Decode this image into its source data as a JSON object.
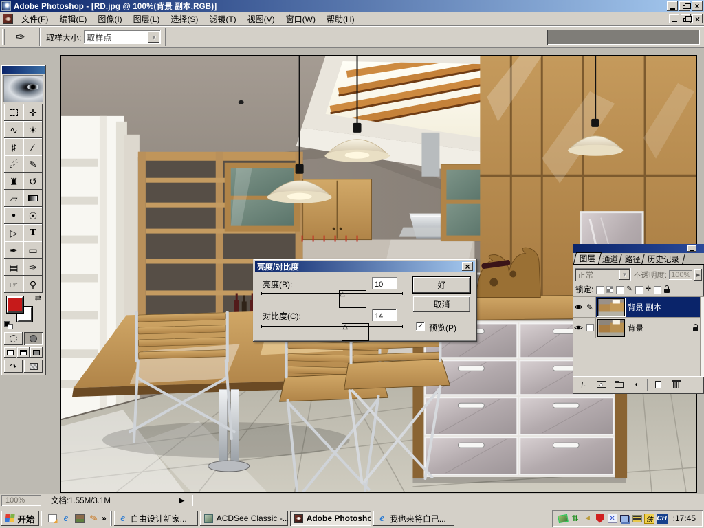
{
  "window": {
    "title": "Adobe Photoshop - [RD.jpg @ 100%(背景 副本,RGB)]"
  },
  "menu_bar": {
    "items": [
      "文件(F)",
      "编辑(E)",
      "图像(I)",
      "图层(L)",
      "选择(S)",
      "滤镜(T)",
      "视图(V)",
      "窗口(W)",
      "帮助(H)"
    ]
  },
  "options_bar": {
    "sample_size_label": "取样大小:",
    "sample_size_value": "取样点"
  },
  "toolbox": {
    "tools": [
      {
        "name": "rectangular-marquee",
        "glyph": ""
      },
      {
        "name": "move",
        "glyph": "✛"
      },
      {
        "name": "lasso",
        "glyph": "∿"
      },
      {
        "name": "magic-wand",
        "glyph": "✶"
      },
      {
        "name": "crop",
        "glyph": "♯"
      },
      {
        "name": "slice",
        "glyph": "∕"
      },
      {
        "name": "airbrush",
        "glyph": "☄"
      },
      {
        "name": "paintbrush",
        "glyph": "✎"
      },
      {
        "name": "clone-stamp",
        "glyph": "♜"
      },
      {
        "name": "history-brush",
        "glyph": "↺"
      },
      {
        "name": "eraser",
        "glyph": "▱"
      },
      {
        "name": "gradient",
        "glyph": ""
      },
      {
        "name": "blur",
        "glyph": "●"
      },
      {
        "name": "dodge",
        "glyph": "☉"
      },
      {
        "name": "path-select",
        "glyph": "▷"
      },
      {
        "name": "type",
        "glyph": "T"
      },
      {
        "name": "pen",
        "glyph": "✒"
      },
      {
        "name": "rectangle",
        "glyph": "▭"
      },
      {
        "name": "notes",
        "glyph": "▤"
      },
      {
        "name": "eyedropper",
        "glyph": "✑"
      },
      {
        "name": "hand",
        "glyph": "☞"
      },
      {
        "name": "zoom",
        "glyph": "⚲"
      }
    ]
  },
  "dialog": {
    "title": "亮度/对比度",
    "brightness_label": "亮度(B):",
    "brightness_value": "10",
    "contrast_label": "对比度(C):",
    "contrast_value": "14",
    "ok_label": "好",
    "cancel_label": "取消",
    "preview_label": "预览(P)"
  },
  "layers_palette": {
    "tabs": [
      "图层",
      "通道",
      "路径",
      "历史记录"
    ],
    "blend_mode_value": "正常",
    "opacity_label": "不透明度:",
    "opacity_value": "100%",
    "lock_label": "锁定:",
    "layers": [
      {
        "name": "背景 副本"
      },
      {
        "name": "背景"
      }
    ]
  },
  "status_bar": {
    "zoom_value": "100%",
    "document_info": "文档:1.55M/3.1M"
  },
  "taskbar": {
    "start_label": "开始",
    "task_buttons": [
      "自由设计新家...",
      "ACDSee Classic -...",
      "Adobe Photosho...",
      "我也来将自己..."
    ],
    "input_indicator": "CH",
    "xia_badge": "侠",
    "clock": ":17:45"
  },
  "icons": {
    "close": "×",
    "dropdown_arrow": "▼",
    "spinner_arrow": "▶",
    "status_arrow": "▶",
    "chevron": "»",
    "ie_glyph": "e",
    "swap_glyph": "⇄",
    "slider_thumb": "△",
    "check": "✓",
    "brush_glyph": "✎",
    "move_glyph": "✛",
    "effects_glyph": "ƒ.",
    "adjustment_glyph": "◐",
    "arrows_updown": "⇅",
    "speaker_glyph": "◄",
    "x_glyph": "✕",
    "jump_glyph": "↷"
  }
}
